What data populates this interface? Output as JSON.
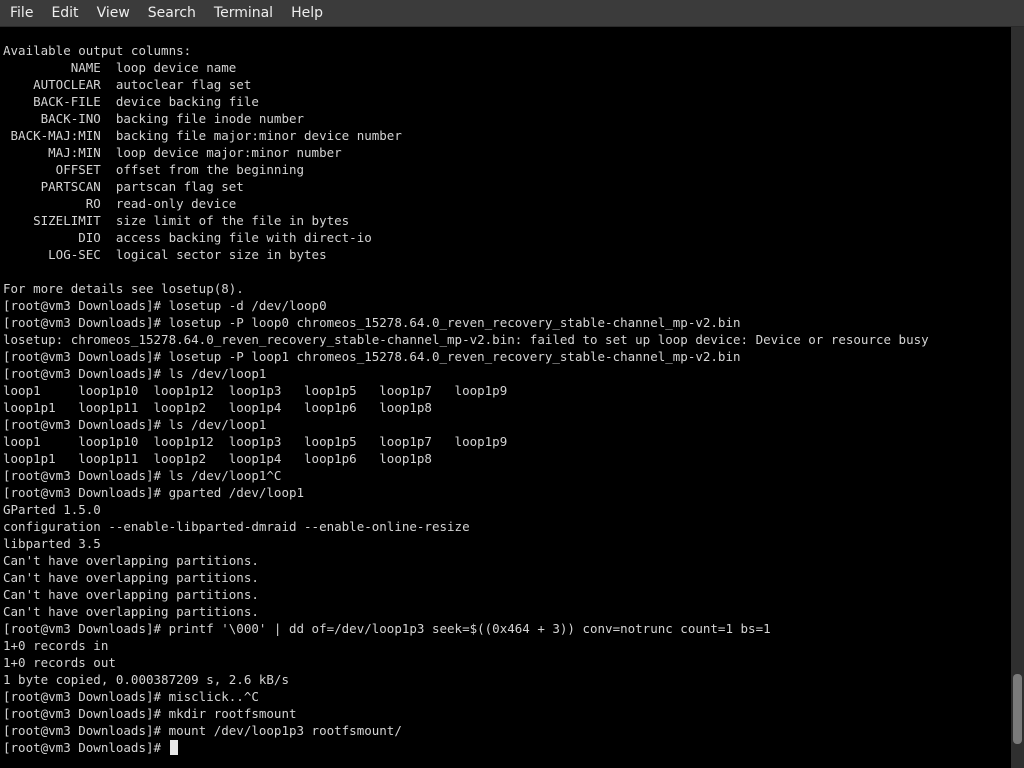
{
  "menubar": {
    "items": [
      "File",
      "Edit",
      "View",
      "Search",
      "Terminal",
      "Help"
    ]
  },
  "terminal": {
    "lines": [
      "Available output columns:",
      "         NAME  loop device name",
      "    AUTOCLEAR  autoclear flag set",
      "    BACK-FILE  device backing file",
      "     BACK-INO  backing file inode number",
      " BACK-MAJ:MIN  backing file major:minor device number",
      "      MAJ:MIN  loop device major:minor number",
      "       OFFSET  offset from the beginning",
      "     PARTSCAN  partscan flag set",
      "           RO  read-only device",
      "    SIZELIMIT  size limit of the file in bytes",
      "          DIO  access backing file with direct-io",
      "      LOG-SEC  logical sector size in bytes",
      "",
      "For more details see losetup(8).",
      "[root@vm3 Downloads]# losetup -d /dev/loop0",
      "[root@vm3 Downloads]# losetup -P loop0 chromeos_15278.64.0_reven_recovery_stable-channel_mp-v2.bin",
      "losetup: chromeos_15278.64.0_reven_recovery_stable-channel_mp-v2.bin: failed to set up loop device: Device or resource busy",
      "[root@vm3 Downloads]# losetup -P loop1 chromeos_15278.64.0_reven_recovery_stable-channel_mp-v2.bin",
      "[root@vm3 Downloads]# ls /dev/loop1",
      "loop1     loop1p10  loop1p12  loop1p3   loop1p5   loop1p7   loop1p9",
      "loop1p1   loop1p11  loop1p2   loop1p4   loop1p6   loop1p8",
      "[root@vm3 Downloads]# ls /dev/loop1",
      "loop1     loop1p10  loop1p12  loop1p3   loop1p5   loop1p7   loop1p9",
      "loop1p1   loop1p11  loop1p2   loop1p4   loop1p6   loop1p8",
      "[root@vm3 Downloads]# ls /dev/loop1^C",
      "[root@vm3 Downloads]# gparted /dev/loop1",
      "GParted 1.5.0",
      "configuration --enable-libparted-dmraid --enable-online-resize",
      "libparted 3.5",
      "Can't have overlapping partitions.",
      "Can't have overlapping partitions.",
      "Can't have overlapping partitions.",
      "Can't have overlapping partitions.",
      "[root@vm3 Downloads]# printf '\\000' | dd of=/dev/loop1p3 seek=$((0x464 + 3)) conv=notrunc count=1 bs=1",
      "1+0 records in",
      "1+0 records out",
      "1 byte copied, 0.000387209 s, 2.6 kB/s",
      "[root@vm3 Downloads]# misclick..^C",
      "[root@vm3 Downloads]# mkdir rootfsmount",
      "[root@vm3 Downloads]# mount /dev/loop1p3 rootfsmount/",
      "[root@vm3 Downloads]# "
    ]
  },
  "scrollbar": {
    "position": 0.97
  }
}
